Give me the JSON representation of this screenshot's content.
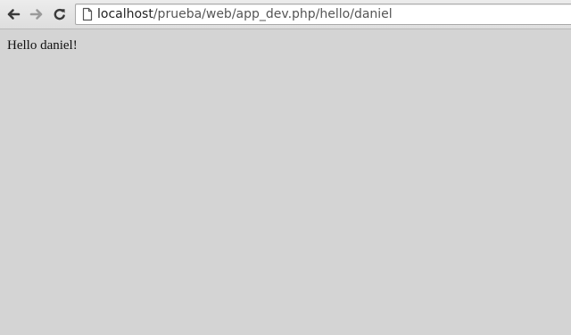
{
  "toolbar": {
    "back_icon": "back-arrow-icon",
    "forward_icon": "forward-arrow-icon",
    "reload_icon": "reload-icon",
    "page_icon": "page-icon",
    "url_host": "localhost",
    "url_path": "/prueba/web/app_dev.php/hello/daniel"
  },
  "page": {
    "text": "Hello daniel!",
    "background_color": "#d4d4d4"
  }
}
